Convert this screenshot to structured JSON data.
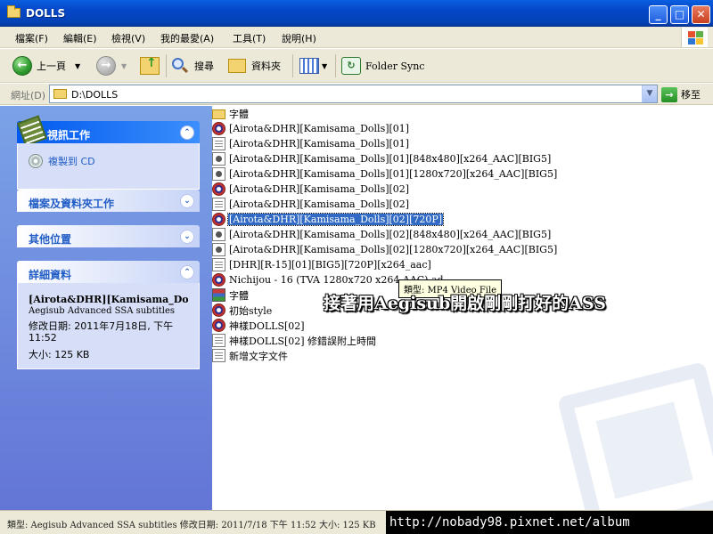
{
  "window": {
    "title": "DOLLS"
  },
  "menu": [
    "檔案(F)",
    "編輯(E)",
    "檢視(V)",
    "我的最愛(A)",
    "工具(T)",
    "說明(H)"
  ],
  "toolbar": {
    "back": "上一頁",
    "search": "搜尋",
    "folders": "資料夾",
    "folder_sync": "Folder Sync"
  },
  "address": {
    "label": "網址(D)",
    "path": "D:\\DOLLS",
    "go": "移至"
  },
  "tasks": {
    "media_tasks": {
      "title": "視訊工作",
      "item": "複製到 CD"
    },
    "file_tasks": {
      "title": "檔案及資料夾工作"
    },
    "other_places": {
      "title": "其他位置"
    },
    "details": {
      "title": "詳細資料",
      "name": "[Airota&DHR][Kamisama_Doll",
      "type": "Aegisub Advanced SSA subtitles",
      "modified": "修改日期: 2011年7月18日, 下午 11:52",
      "size": "大小: 125 KB"
    }
  },
  "files": [
    {
      "name": "字體",
      "icon": "folder-icon"
    },
    {
      "name": "[Airota&DHR][Kamisama_Dolls][01]",
      "icon": "media-icon"
    },
    {
      "name": "[Airota&DHR][Kamisama_Dolls][01]",
      "icon": "document-icon"
    },
    {
      "name": "[Airota&DHR][Kamisama_Dolls][01][848x480][x264_AAC][BIG5]",
      "icon": "video-icon"
    },
    {
      "name": "[Airota&DHR][Kamisama_Dolls][01][1280x720][x264_AAC][BIG5]",
      "icon": "video-icon"
    },
    {
      "name": "[Airota&DHR][Kamisama_Dolls][02]",
      "icon": "media-icon"
    },
    {
      "name": "[Airota&DHR][Kamisama_Dolls][02]",
      "icon": "document-icon"
    },
    {
      "name": "[Airota&DHR][Kamisama_Dolls][02][720P]",
      "icon": "media-icon",
      "selected": true
    },
    {
      "name": "[Airota&DHR][Kamisama_Dolls][02][848x480][x264_AAC][BIG5]",
      "icon": "video-icon"
    },
    {
      "name": "[Airota&DHR][Kamisama_Dolls][02][1280x720][x264_AAC][BIG5]",
      "icon": "video-icon"
    },
    {
      "name": "[DHR][R-15][01][BIG5][720P][x264_aac]",
      "icon": "document-icon"
    },
    {
      "name": "Nichijou - 16 (TVA 1280x720 x264 AAC).ad",
      "icon": "media-icon"
    },
    {
      "name": "字體",
      "icon": "font-icon"
    },
    {
      "name": "初始style",
      "icon": "media-icon"
    },
    {
      "name": "神樣DOLLS[02]",
      "icon": "media-icon"
    },
    {
      "name": "神樣DOLLS[02] 修錯誤附上時間",
      "icon": "document-icon"
    },
    {
      "name": "新增文字文件",
      "icon": "document-icon"
    }
  ],
  "tooltip": "類型: MP4 Video File",
  "overlay_caption": "接著用Aegisub開啟剛剛打好的ASS",
  "status": {
    "text": "類型: Aegisub Advanced SSA subtitles 修改日期: 2011/7/18 下午 11:52 大小: 125 KB",
    "url": "http://nobady98.pixnet.net/album"
  }
}
